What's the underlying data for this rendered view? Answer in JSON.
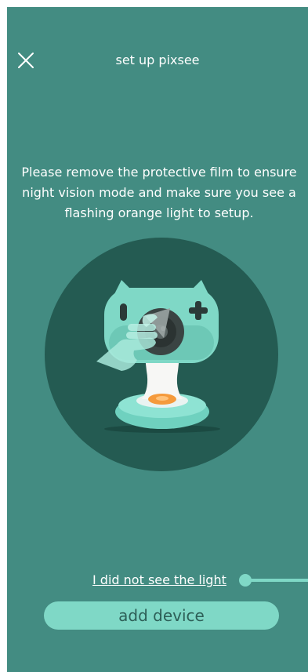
{
  "header": {
    "title": "set up pixsee",
    "close_icon": "close-icon"
  },
  "instructions": {
    "text": "Please remove the protective film to ensure night vision mode and make sure you see a flashing orange light to setup."
  },
  "illustration": {
    "icon": "pixsee-camera-illustration"
  },
  "help": {
    "link_text": "I did not see the light"
  },
  "actions": {
    "add_device_label": "add device"
  },
  "colors": {
    "background": "#438c82",
    "accent": "#7fd8c6",
    "circle": "#245b52",
    "button_text": "#2d5f57",
    "light": "#f59a3c"
  }
}
